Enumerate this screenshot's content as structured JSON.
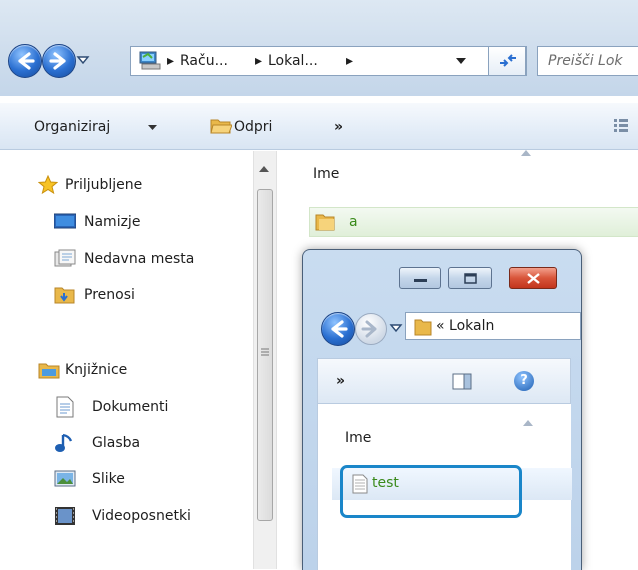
{
  "address_bar": {
    "crumbs": [
      "Raču...",
      "Lokal..."
    ],
    "search_placeholder": "Preišči Lok"
  },
  "toolbar": {
    "organize_label": "Organiziraj",
    "open_label": "Odpri",
    "more_label": "»"
  },
  "sidebar": {
    "favorites_label": "Priljubljene",
    "favorites": [
      "Namizje",
      "Nedavna mesta",
      "Prenosi"
    ],
    "libraries_label": "Knjižnice",
    "libraries": [
      "Dokumenti",
      "Glasba",
      "Slike",
      "Videoposnetki"
    ]
  },
  "main_list": {
    "column_name": "Ime",
    "items": [
      "a"
    ]
  },
  "dialog": {
    "address_text": "« Lokaln",
    "more_label": "»",
    "help_label": "?",
    "column_name": "Ime",
    "items": [
      "test"
    ]
  },
  "colors": {
    "accent_highlight": "#1a86c9",
    "folder": "#e9b84a",
    "item_text_green": "#3a8a1a"
  }
}
